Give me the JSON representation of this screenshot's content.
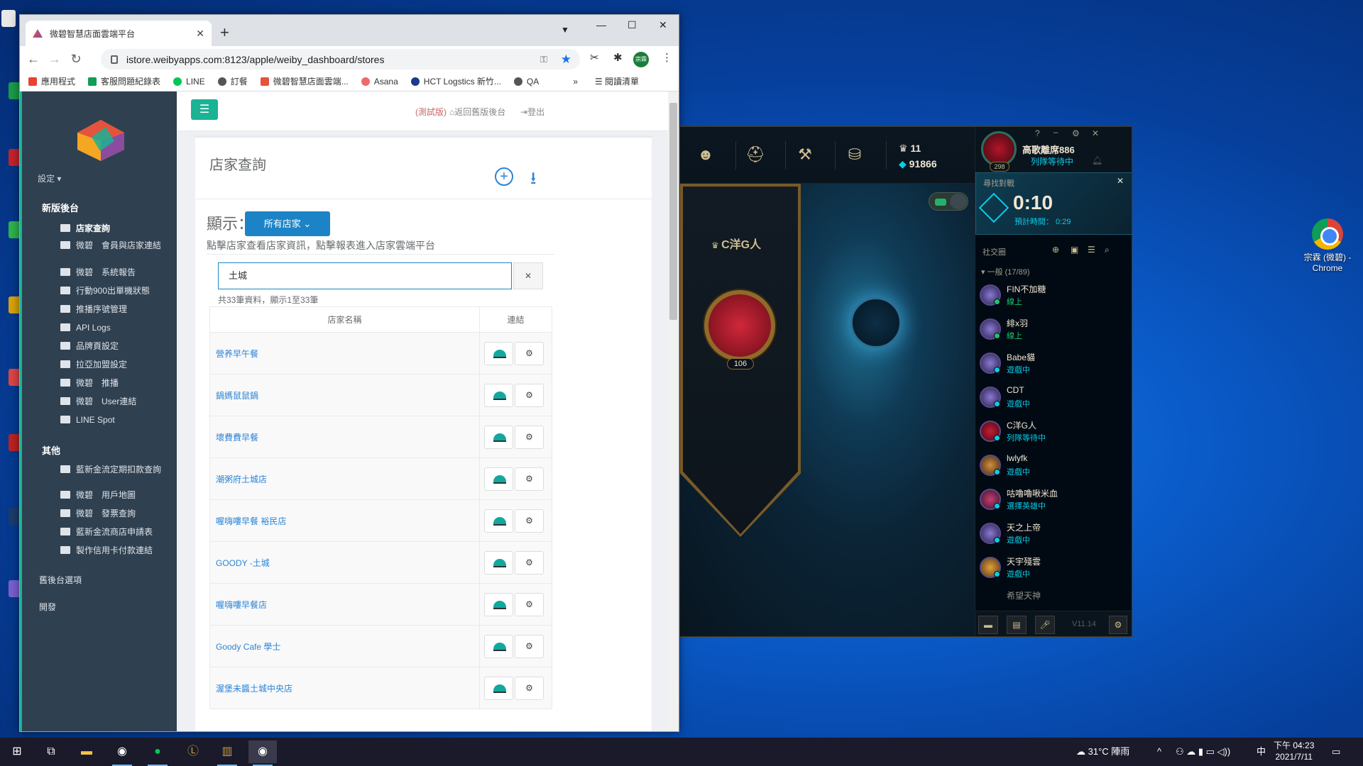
{
  "desktop": {
    "chrome_shortcut_label": "宗霖 (微碧) - Chrome"
  },
  "browser": {
    "tab_title": "微碧智慧店面雲端平台",
    "url": "istore.weibyapps.com:8123/apple/weiby_dashboard/stores",
    "bookmarks": [
      "應用程式",
      "客服問題紀錄表",
      "LINE",
      "訂餐",
      "微碧智慧店面雲端...",
      "Asana",
      "HCT Logstics 新竹...",
      "QA"
    ],
    "reading_list": "閱讀清單",
    "profile_badge": "宗霖"
  },
  "sidebar": {
    "settings": "設定 ▾",
    "group1": "新版後台",
    "items1": [
      "店家查詢",
      "微碧　會員與店家連結",
      "微碧　系統報告",
      "行動900出單機狀態",
      "推播序號管理",
      "API Logs",
      "品牌頁設定",
      "拉亞加盟設定",
      "微碧　推播",
      "微碧　User連結",
      "LINE Spot"
    ],
    "group2": "其他",
    "items2": [
      "藍新金流定期扣款查詢",
      "微碧　用戶地圖",
      "微碧　發票查詢",
      "藍新金流商店申請表",
      "製作信用卡付款連結"
    ],
    "bottom": [
      "舊後台選項",
      "開發"
    ]
  },
  "topbar": {
    "test_label": "(測試版)",
    "back_label": "返回舊版後台",
    "logout_label": "登出"
  },
  "main": {
    "title": "店家查詢",
    "show_label": "顯示：",
    "filter": "所有店家",
    "hint": "點擊店家查看店家資訊，點擊報表進入店家雲端平台",
    "search_value": "土城",
    "count_text": "共33筆資料，顯示1至33筆",
    "col_name": "店家名稱",
    "col_link": "連結",
    "rows": [
      "營养早午餐",
      "鍋媽鼠鼠鍋",
      "壞費費早餐",
      "潮粥府土城店",
      "喔嗨嘍早餐 裕民店",
      "GOODY -土城",
      "喔嗨嘍早餐店",
      "Goody Cafe 學士",
      "渥堡未醬土城中央店"
    ]
  },
  "lol": {
    "champ_count": "11",
    "be": "91866",
    "banner_name": "C洋G人",
    "banner_level": "106",
    "player_name": "高歌離席886",
    "player_status": "列隊等待中",
    "player_level": "298",
    "queue_title": "尋找對戰",
    "queue_time": "0:10",
    "queue_est": "預計時間： 0:29",
    "social_title": "社交圈",
    "group": "一般 (17/89)",
    "friends": [
      {
        "name": "FIN不加糖",
        "status": "線上"
      },
      {
        "name": "緋x羽",
        "status": "線上"
      },
      {
        "name": "Babe貓",
        "status": "遊戲中"
      },
      {
        "name": "CDT",
        "status": "遊戲中"
      },
      {
        "name": "C洋G人",
        "status": "列隊等待中"
      },
      {
        "name": "lwlyfk",
        "status": "遊戲中"
      },
      {
        "name": "咕嚕嚕啾米血",
        "status": "選擇英雄中"
      },
      {
        "name": "天之上帝",
        "status": "遊戲中"
      },
      {
        "name": "天宇殘雲",
        "status": "遊戲中"
      },
      {
        "name": "希望天神",
        "status": ""
      }
    ],
    "version": "V11.14"
  },
  "taskbar": {
    "weather": "31°C 陣雨",
    "ime": "中",
    "time": "下午 04:23",
    "date": "2021/7/11"
  }
}
